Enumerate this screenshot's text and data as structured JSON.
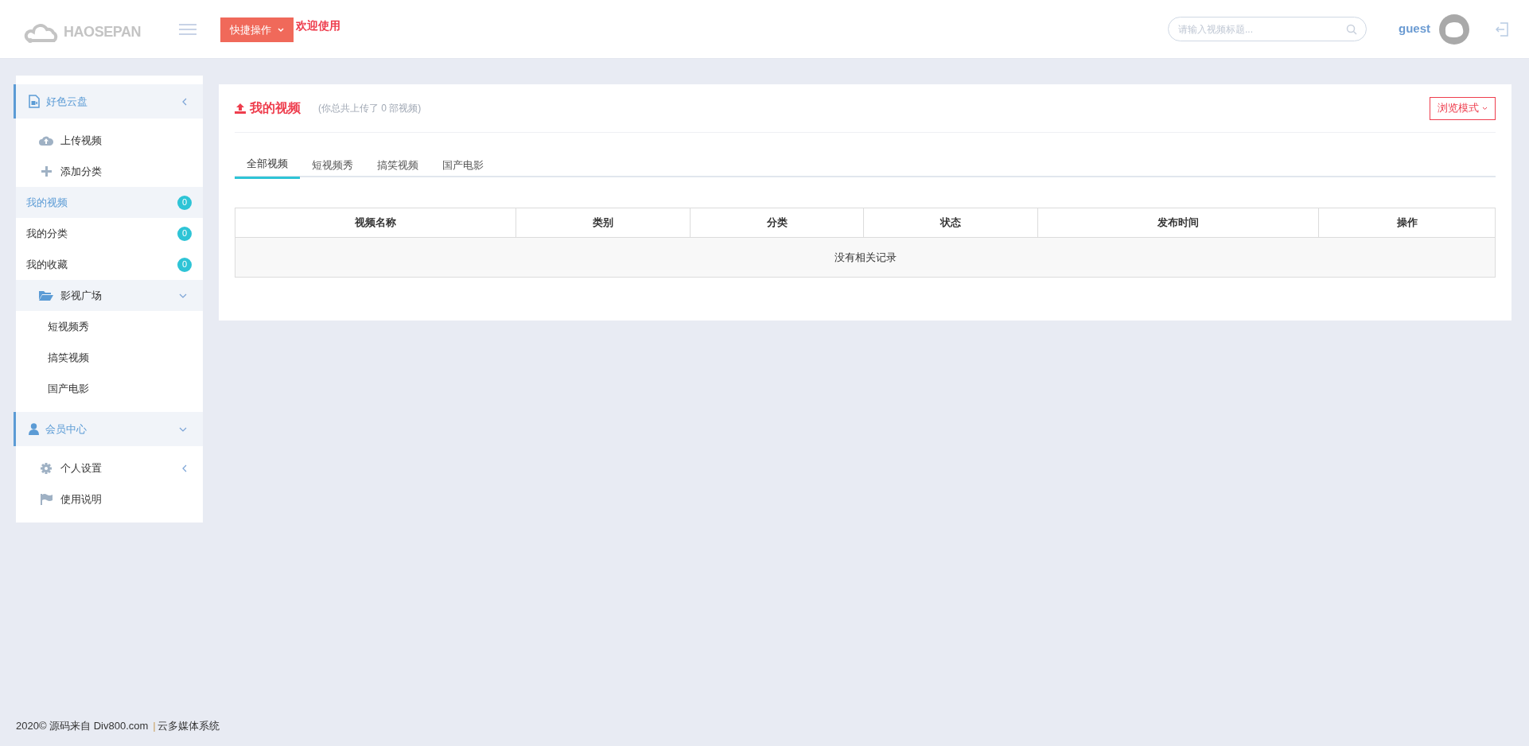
{
  "header": {
    "logo": "HAOSEPAN",
    "quick_button": "快捷操作",
    "welcome": "欢迎使用",
    "search": {
      "placeholder": "请输入视频标题..."
    },
    "user": "guest"
  },
  "sidebar": {
    "sections": [
      {
        "label": "好色云盘",
        "expanded": false,
        "items": [
          {
            "kind": "icon",
            "label": "上传视频",
            "selected": false
          },
          {
            "kind": "icon",
            "label": "添加分类",
            "selected": false
          },
          {
            "kind": "count",
            "label": "我的视频",
            "badge": "0",
            "selected": true
          },
          {
            "kind": "count",
            "label": "我的分类",
            "badge": "0",
            "selected": false
          },
          {
            "kind": "count",
            "label": "我的收藏",
            "badge": "0",
            "selected": false
          },
          {
            "kind": "group",
            "label": "影视广场",
            "expanded": true,
            "selected": false,
            "children": [
              {
                "label": "短视频秀",
                "selected": false
              },
              {
                "label": "搞笑视频",
                "selected": false
              },
              {
                "label": "国产电影",
                "selected": false
              }
            ]
          }
        ]
      },
      {
        "label": "会员中心",
        "expanded": true,
        "items": [
          {
            "kind": "group",
            "label": "个人设置",
            "expanded": false,
            "selected": false
          },
          {
            "kind": "icon",
            "label": "使用说明",
            "selected": false
          }
        ]
      }
    ]
  },
  "content": {
    "title": "我的视频",
    "subtitle": "(你总共上传了 0 部视频)",
    "mode_button": "浏览模式",
    "tabs": [
      {
        "label": "全部视频",
        "selected": true
      },
      {
        "label": "短视频秀",
        "selected": false
      },
      {
        "label": "搞笑视频",
        "selected": false
      },
      {
        "label": "国产电影",
        "selected": false
      }
    ],
    "table": {
      "columns": [
        "视频名称",
        "类别",
        "分类",
        "状态",
        "发布时间",
        "操作"
      ],
      "empty_message": "没有相关记录"
    }
  },
  "footer": {
    "copyright": "2020© 源码来自 Div800.com",
    "separator": "|",
    "system": "云多媒体系统"
  }
}
